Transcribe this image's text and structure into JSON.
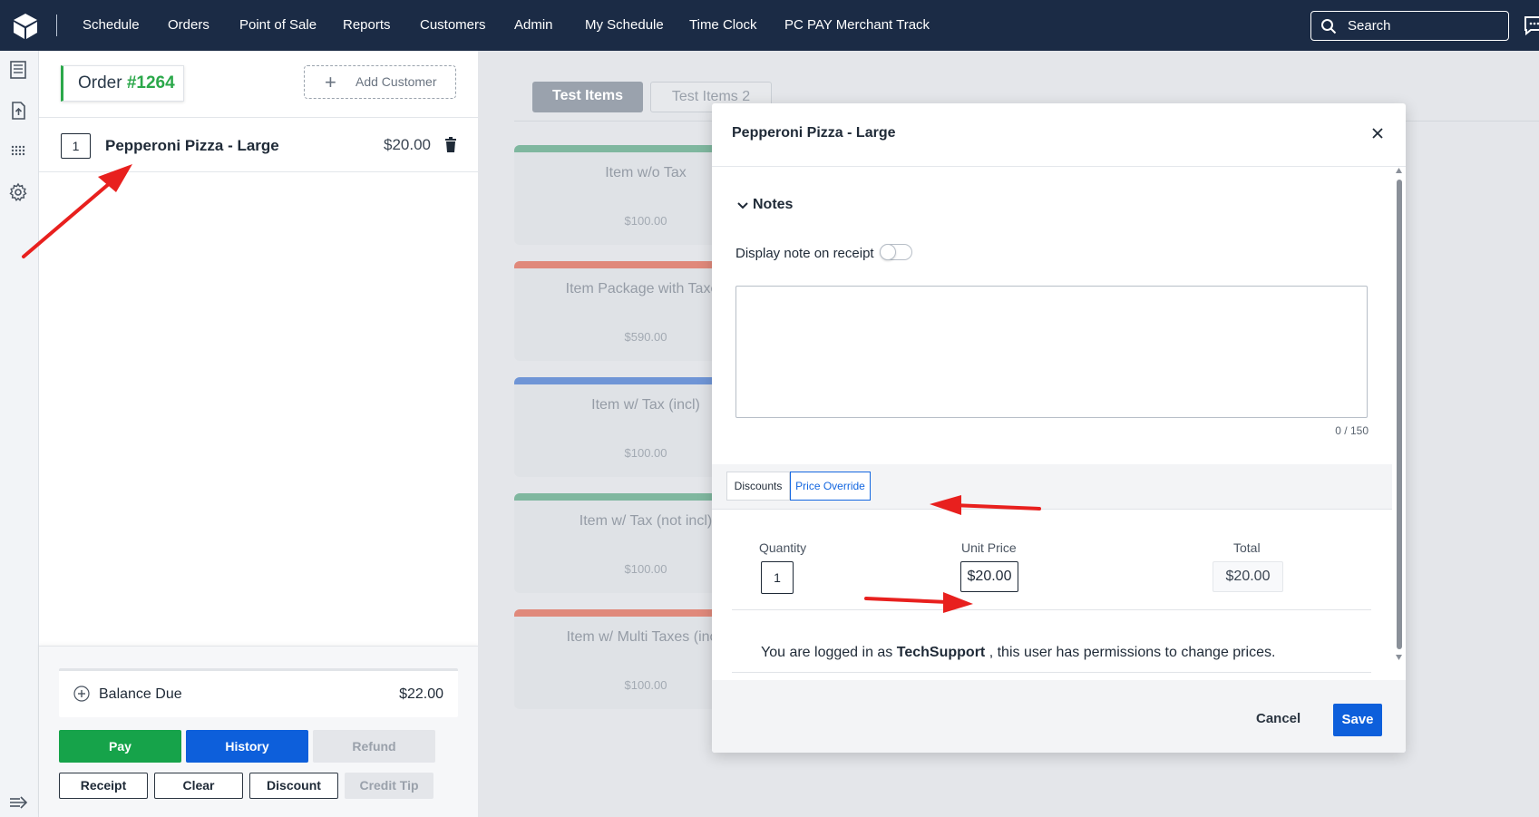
{
  "nav": {
    "items": [
      "Schedule",
      "Orders",
      "Point of Sale",
      "Reports",
      "Customers",
      "Admin",
      "My Schedule",
      "Time Clock",
      "PC PAY Merchant Track"
    ],
    "search_label": "Search"
  },
  "order": {
    "label": "Order",
    "number": "#1264",
    "add_customer_label": "Add Customer",
    "line_item": {
      "qty": "1",
      "name": "Pepperoni Pizza - Large",
      "price": "$20.00"
    },
    "balance_label": "Balance Due",
    "balance_amount": "$22.00",
    "buttons": {
      "pay": "Pay",
      "history": "History",
      "refund": "Refund",
      "receipt": "Receipt",
      "clear": "Clear",
      "discount": "Discount",
      "credit_tip": "Credit Tip"
    }
  },
  "catalog": {
    "tabs": [
      "Test Items",
      "Test Items 2"
    ],
    "items": [
      {
        "name": "Item w/o Tax",
        "price": "$100.00",
        "color": "#7fb79f"
      },
      {
        "name": "Item Package with Taxes",
        "price": "$590.00",
        "color": "#e0897b"
      },
      {
        "name": "Item w/ Tax (incl)",
        "price": "$100.00",
        "color": "#6f95d6"
      },
      {
        "name": "Item w/ Tax (not incl)",
        "price": "$100.00",
        "color": "#7fb79f"
      },
      {
        "name": "Item w/ Multi Taxes (incl)",
        "price": "$100.00",
        "color": "#e0897b"
      }
    ]
  },
  "modal": {
    "title": "Pepperoni Pizza - Large",
    "notes_label": "Notes",
    "display_note_label": "Display note on receipt",
    "note_value": "",
    "note_counter": "0 / 150",
    "tabs": {
      "discounts": "Discounts",
      "price_override": "Price Override"
    },
    "quantity_label": "Quantity",
    "quantity_value": "1",
    "unit_price_label": "Unit Price",
    "unit_price_value": "$20.00",
    "total_label": "Total",
    "total_value": "$20.00",
    "permission": {
      "prefix": "You are logged in as",
      "user": "TechSupport",
      "suffix": ", this user has permissions to change prices."
    },
    "cancel_label": "Cancel",
    "save_label": "Save"
  },
  "colors": {
    "nav_bg": "#1b2b45",
    "accent_green": "#2ba84a",
    "primary_blue": "#0d5fdb",
    "annotation_red": "#e8201e"
  }
}
